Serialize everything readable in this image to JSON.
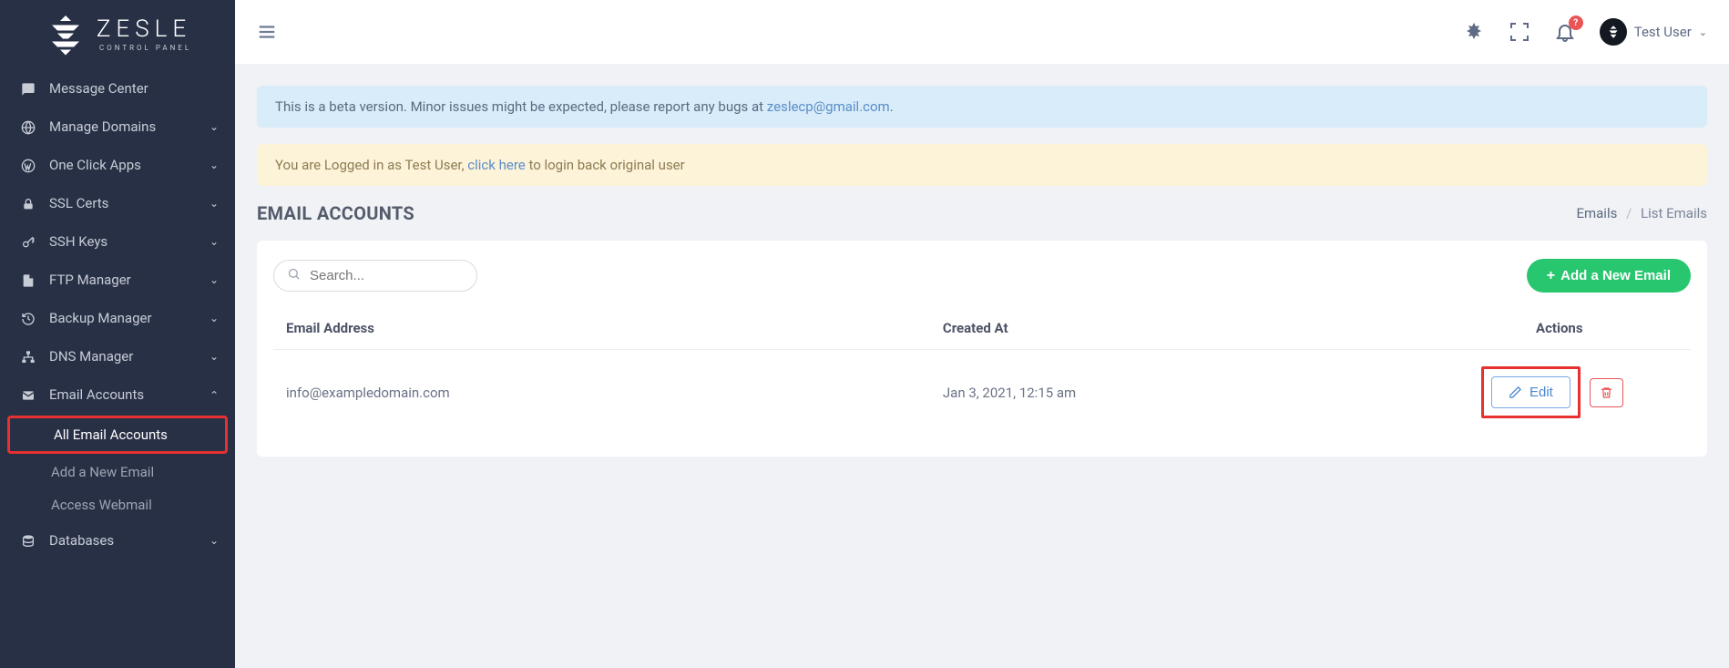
{
  "brand": {
    "name": "ZESLE",
    "subtitle": "CONTROL PANEL"
  },
  "sidebar": {
    "items": [
      {
        "label": "Message Center",
        "icon": "chat",
        "expandable": false
      },
      {
        "label": "Manage Domains",
        "icon": "globe",
        "expandable": true
      },
      {
        "label": "One Click Apps",
        "icon": "wp",
        "expandable": true
      },
      {
        "label": "SSL Certs",
        "icon": "lock",
        "expandable": true
      },
      {
        "label": "SSH Keys",
        "icon": "key",
        "expandable": true
      },
      {
        "label": "FTP Manager",
        "icon": "file",
        "expandable": true
      },
      {
        "label": "Backup Manager",
        "icon": "history",
        "expandable": true
      },
      {
        "label": "DNS Manager",
        "icon": "sitemap",
        "expandable": true
      },
      {
        "label": "Email Accounts",
        "icon": "mail",
        "expandable": true,
        "expanded": true
      },
      {
        "label": "Databases",
        "icon": "db",
        "expandable": true
      }
    ],
    "email_sub": [
      {
        "label": "All Email Accounts",
        "active": true
      },
      {
        "label": "Add a New Email",
        "active": false
      },
      {
        "label": "Access Webmail",
        "active": false
      }
    ]
  },
  "topbar": {
    "notification_badge": "?",
    "user_name": "Test User"
  },
  "alerts": {
    "beta_prefix": "This is a beta version. Minor issues might be expected, please report any bugs at ",
    "beta_link": "zeslecp@gmail.com",
    "beta_suffix": ".",
    "login_prefix": "You are Logged in as Test User, ",
    "login_link": "click here",
    "login_suffix": " to login back original user"
  },
  "page": {
    "title": "EMAIL ACCOUNTS",
    "crumb_root": "Emails",
    "crumb_leaf": "List Emails",
    "search_placeholder": "Search...",
    "add_button": "Add a New Email",
    "columns": {
      "address": "Email Address",
      "created": "Created At",
      "actions": "Actions"
    },
    "edit_label": "Edit",
    "rows": [
      {
        "address": "info@exampledomain.com",
        "created": "Jan 3, 2021, 12:15 am"
      }
    ]
  }
}
